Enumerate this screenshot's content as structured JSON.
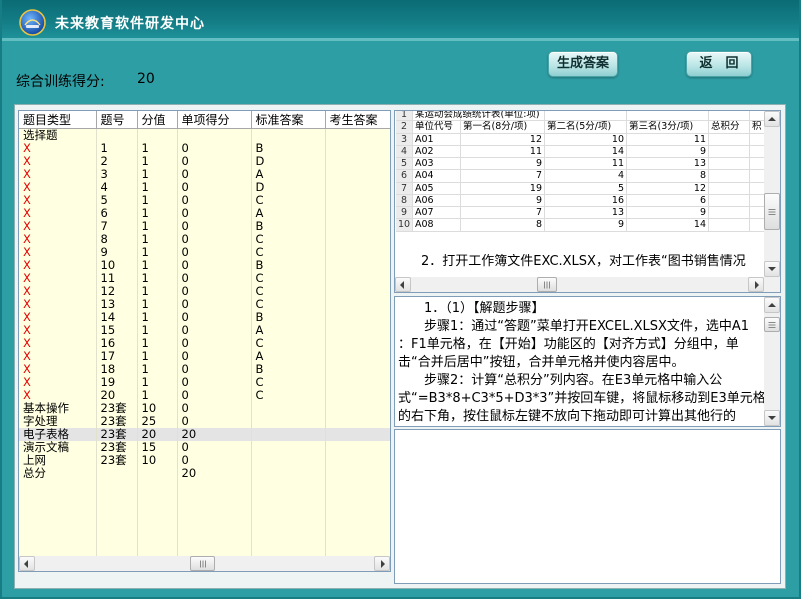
{
  "window": {
    "title": "未来教育软件研发中心",
    "icon": "app-logo-icon"
  },
  "score": {
    "label": "综合训练得分:",
    "value": "20"
  },
  "buttons": {
    "generate": "生成答案",
    "back": "返　回"
  },
  "colors": {
    "title_bar": "#137c85",
    "background": "#2e9ea5",
    "button": "#b9e4e5",
    "table_background": "#ffffe1",
    "wrong_mark": "#e00000",
    "selected_row": "#e4e4e4"
  },
  "result_table": {
    "headers": [
      "题目类型",
      "题号",
      "分值",
      "单项得分",
      "标准答案",
      "考生答案"
    ],
    "wrong_mark": "X",
    "selected_row": 23,
    "rows": [
      [
        "选择题",
        "",
        "",
        "",
        "",
        ""
      ],
      [
        "X",
        "1",
        "1",
        "0",
        "B",
        ""
      ],
      [
        "X",
        "2",
        "1",
        "0",
        "D",
        ""
      ],
      [
        "X",
        "3",
        "1",
        "0",
        "A",
        ""
      ],
      [
        "X",
        "4",
        "1",
        "0",
        "D",
        ""
      ],
      [
        "X",
        "5",
        "1",
        "0",
        "C",
        ""
      ],
      [
        "X",
        "6",
        "1",
        "0",
        "A",
        ""
      ],
      [
        "X",
        "7",
        "1",
        "0",
        "B",
        ""
      ],
      [
        "X",
        "8",
        "1",
        "0",
        "C",
        ""
      ],
      [
        "X",
        "9",
        "1",
        "0",
        "C",
        ""
      ],
      [
        "X",
        "10",
        "1",
        "0",
        "B",
        ""
      ],
      [
        "X",
        "11",
        "1",
        "0",
        "C",
        ""
      ],
      [
        "X",
        "12",
        "1",
        "0",
        "C",
        ""
      ],
      [
        "X",
        "13",
        "1",
        "0",
        "C",
        ""
      ],
      [
        "X",
        "14",
        "1",
        "0",
        "B",
        ""
      ],
      [
        "X",
        "15",
        "1",
        "0",
        "A",
        ""
      ],
      [
        "X",
        "16",
        "1",
        "0",
        "C",
        ""
      ],
      [
        "X",
        "17",
        "1",
        "0",
        "A",
        ""
      ],
      [
        "X",
        "18",
        "1",
        "0",
        "B",
        ""
      ],
      [
        "X",
        "19",
        "1",
        "0",
        "C",
        ""
      ],
      [
        "X",
        "20",
        "1",
        "0",
        "C",
        ""
      ],
      [
        "基本操作",
        "23套",
        "10",
        "0",
        "",
        ""
      ],
      [
        "字处理",
        "23套",
        "25",
        "0",
        "",
        ""
      ],
      [
        "电子表格",
        "23套",
        "20",
        "20",
        "",
        ""
      ],
      [
        "演示文稿",
        "23套",
        "15",
        "0",
        "",
        ""
      ],
      [
        "上网",
        "23套",
        "10",
        "0",
        "",
        ""
      ],
      [
        "总分",
        "",
        "",
        "20",
        "",
        ""
      ]
    ]
  },
  "excel_preview": {
    "rows": [
      {
        "row_number": "1",
        "cells": [
          "某运动会成绩统计表(单位:项)"
        ]
      },
      {
        "row_number": "2",
        "cells": [
          "单位代号",
          "第一名(8分/项)",
          "第二名(5分/项)",
          "第三名(3分/项)",
          "总积分",
          "积"
        ]
      },
      {
        "row_number": "3",
        "cells": [
          "A01",
          "12",
          "10",
          "11"
        ]
      },
      {
        "row_number": "4",
        "cells": [
          "A02",
          "11",
          "14",
          "9"
        ]
      },
      {
        "row_number": "5",
        "cells": [
          "A03",
          "9",
          "11",
          "13"
        ]
      },
      {
        "row_number": "6",
        "cells": [
          "A04",
          "7",
          "4",
          "8"
        ]
      },
      {
        "row_number": "7",
        "cells": [
          "A05",
          "19",
          "5",
          "12"
        ]
      },
      {
        "row_number": "8",
        "cells": [
          "A06",
          "9",
          "16",
          "6"
        ]
      },
      {
        "row_number": "9",
        "cells": [
          "A07",
          "7",
          "13",
          "9"
        ]
      },
      {
        "row_number": "10",
        "cells": [
          "A08",
          "8",
          "9",
          "14"
        ]
      }
    ]
  },
  "question": {
    "text": "　　2．打开工作簿文件EXC.XLSX，对工作表“图书销售情况"
  },
  "solution": {
    "lines": [
      "　　1．（1）【解题步骤】",
      "　　步骤1：通过“答题”菜单打开EXCEL.XLSX文件，选中A1",
      "：F1单元格，在【开始】功能区的【对齐方式】分组中，单",
      "击“合并后居中”按钮，合并单元格并使内容居中。",
      "　　步骤2：计算“总积分”列内容。在E3单元格中输入公",
      "式“=B3*8+C3*5+D3*3”并按回车键，将鼠标移动到E3单元格",
      "的右下角，按住鼠标左键不放向下拖动即可计算出其他行的"
    ]
  }
}
